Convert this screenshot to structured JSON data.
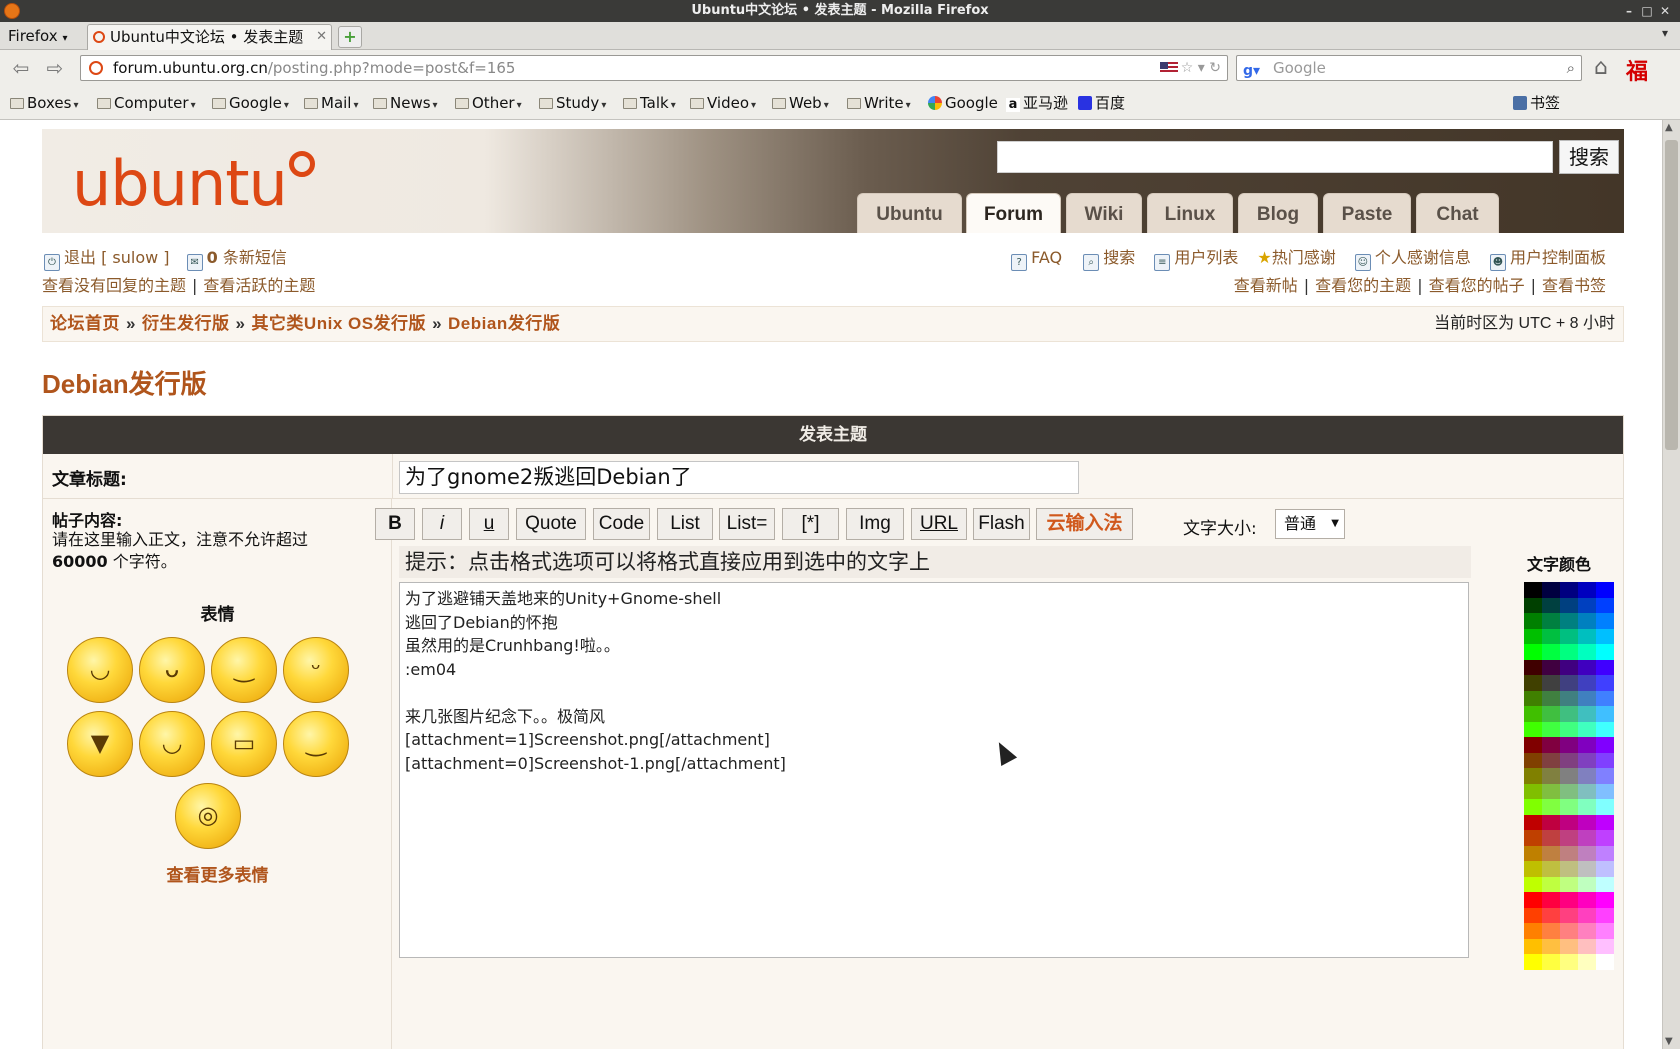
{
  "window": {
    "title": "Ubuntu中文论坛 • 发表主题 - Mozilla Firefox"
  },
  "browser": {
    "menu_label": "Firefox",
    "tab_title": "Ubuntu中文论坛 • 发表主题",
    "url_domain": "forum.ubuntu.org.cn",
    "url_path": "/posting.php?mode=post&f=165",
    "search_placeholder": "Google",
    "bookmarks": [
      "Boxes",
      "Computer",
      "Google",
      "Mail",
      "News",
      "Other",
      "Study",
      "Talk",
      "Video",
      "Web",
      "Write"
    ],
    "bookmark_links": [
      "Google",
      "亚马逊",
      "百度"
    ],
    "bookmarks_menu": "书签"
  },
  "site": {
    "logo_text": "ubuntu",
    "search_button": "搜索",
    "nav_tabs": [
      "Ubuntu",
      "Forum",
      "Wiki",
      "Linux",
      "Blog",
      "Paste",
      "Chat"
    ],
    "active_tab": "Forum",
    "user": {
      "logout": "退出 [ sulow ]",
      "messages_count": "0",
      "messages_label": "条新短信",
      "unanswered": "查看没有回复的主题",
      "active_topics": "查看活跃的主题"
    },
    "right_links": {
      "faq": "FAQ",
      "search": "搜索",
      "members": "用户列表",
      "thanks": "热门感谢",
      "my_thanks": "个人感谢信息",
      "ucp": "用户控制面板"
    },
    "right_links2": {
      "new_posts": "查看新帖",
      "your_topics": "查看您的主题",
      "your_posts": "查看您的帖子",
      "bookmarks": "查看书签"
    },
    "breadcrumb": [
      "论坛首页",
      "衍生发行版",
      "其它类Unix OS发行版",
      "Debian发行版"
    ],
    "timezone": "当前时区为 UTC + 8 小时",
    "forum_title": "Debian发行版"
  },
  "post": {
    "header": "发表主题",
    "subject_label": "文章标题:",
    "subject_value": "为了gnome2叛逃回Debian了",
    "content_label": "帖子内容:",
    "content_hint_1": "请在这里输入正文，注意不允许超过",
    "content_hint_limit": "60000",
    "content_hint_2": " 个字符。",
    "smilies_title": "表情",
    "more_smilies": "查看更多表情",
    "format_buttons": [
      "B",
      "i",
      "u",
      "Quote",
      "Code",
      "List",
      "List=",
      "[*]",
      "Img",
      "URL",
      "Flash",
      "云输入法"
    ],
    "font_size_label": "文字大小:",
    "font_size_value": "普通",
    "hint": "提示：点击格式选项可以将格式直接应用到选中的文字上",
    "color_label": "文字颜色",
    "body": "为了逃避铺天盖地来的Unity+Gnome-shell\n逃回了Debian的怀抱\n虽然用的是Crunhbang!啦。。\n:em04\n\n来几张图片纪念下。。极简风\n[attachment=1]Screenshot.png[/attachment]\n[attachment=0]Screenshot-1.png[/attachment]"
  },
  "colors": {
    "accent": "#dd4814",
    "link": "#b0551c",
    "header_bar": "#3b3733"
  }
}
